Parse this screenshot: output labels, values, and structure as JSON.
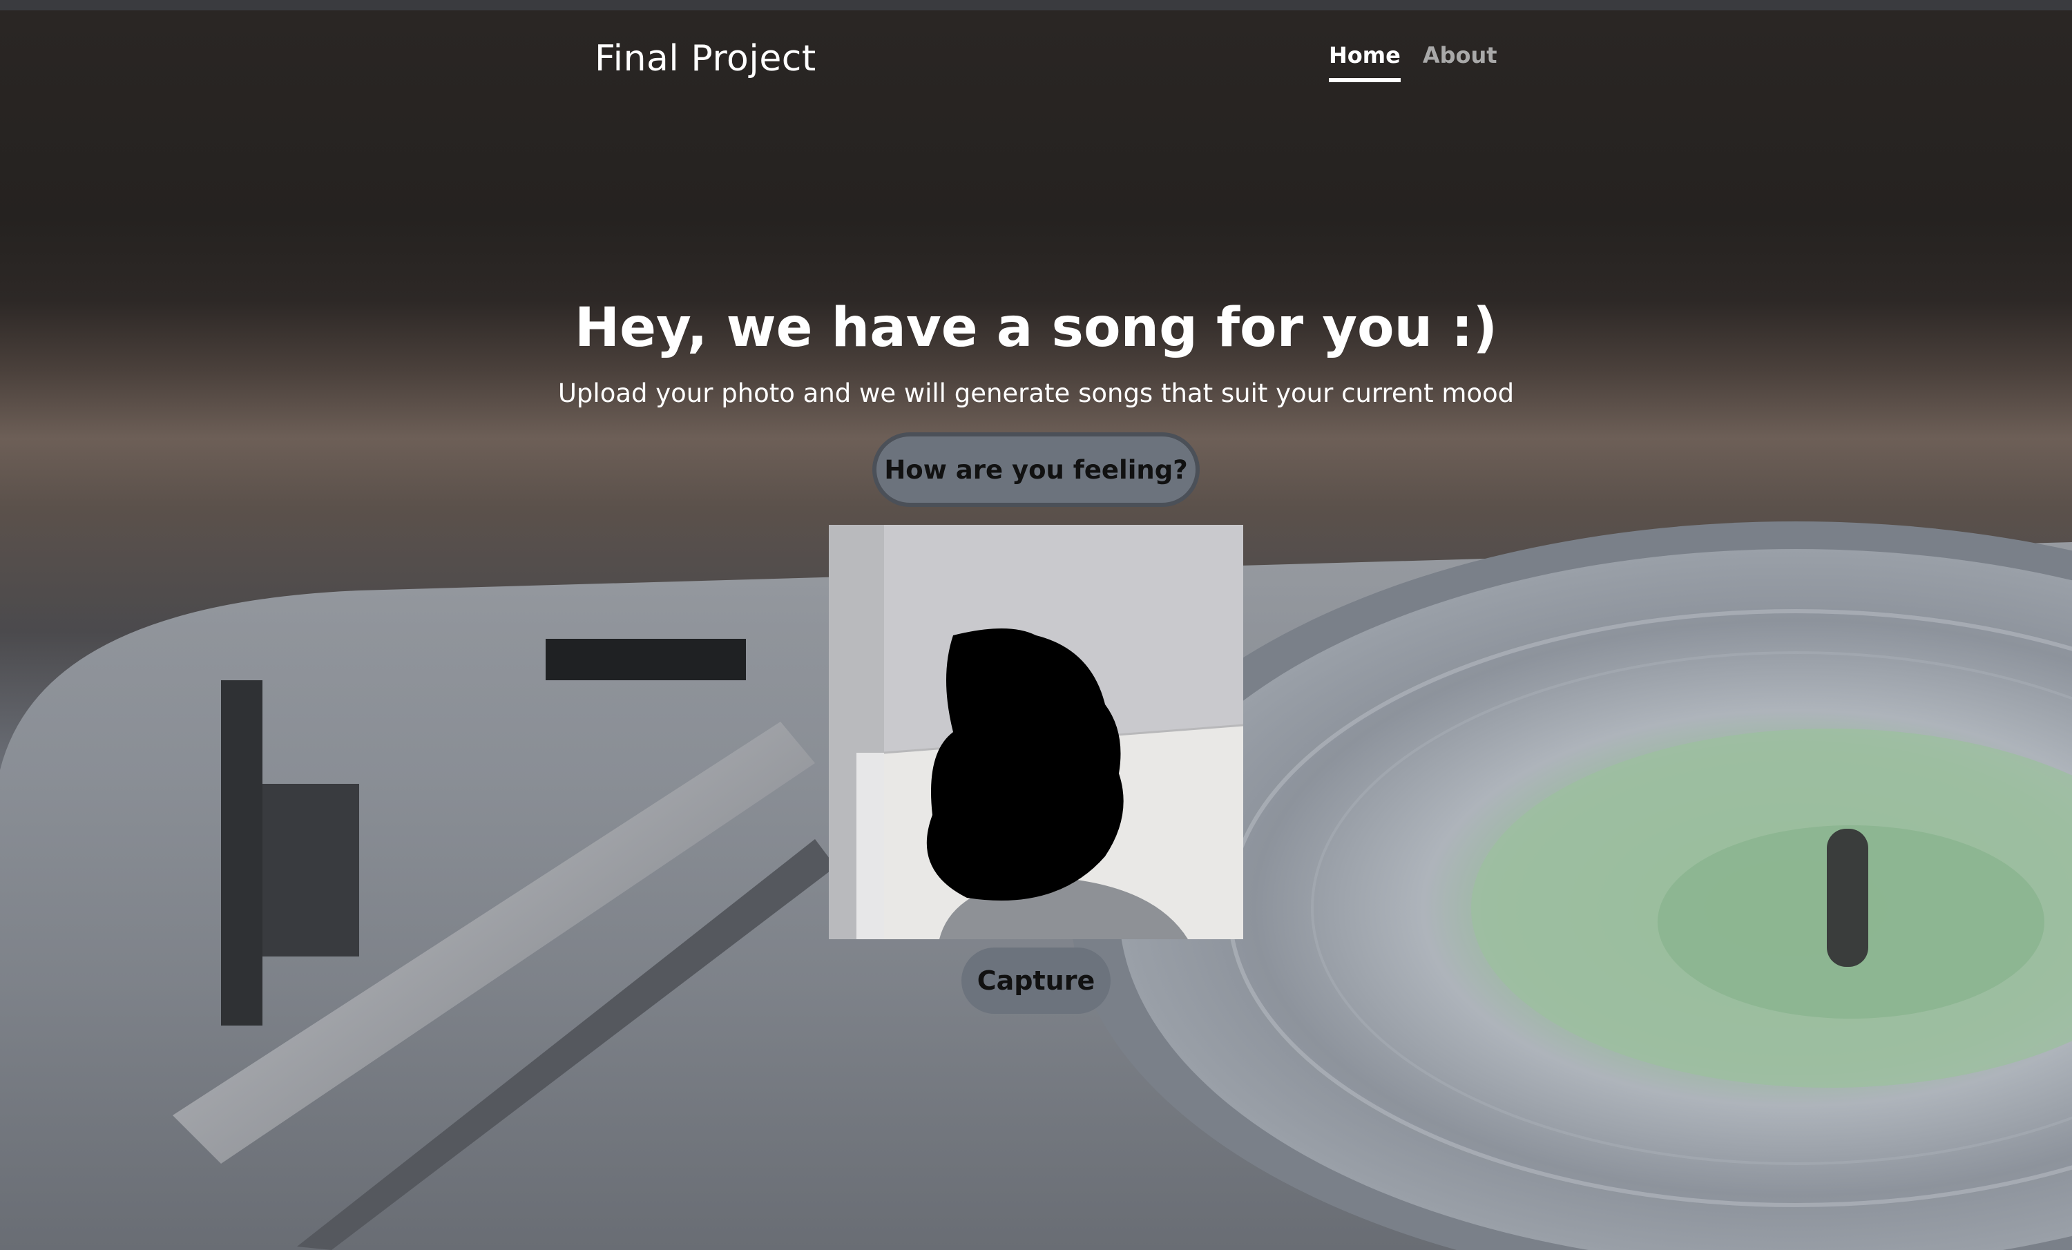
{
  "nav": {
    "brand": "Final Project",
    "links": [
      {
        "label": "Home",
        "active": true
      },
      {
        "label": "About",
        "active": false
      }
    ]
  },
  "hero": {
    "title": "Hey, we have a song for you :)",
    "subtitle": "Upload your photo and we will generate songs that suit your current mood",
    "feeling_button": "How are you feeling?",
    "capture_button": "Capture"
  },
  "colors": {
    "button_bg": "#6c737d",
    "text_light": "#ffffff",
    "nav_inactive": "#a9a9a9",
    "record_label": "#8fb894"
  }
}
